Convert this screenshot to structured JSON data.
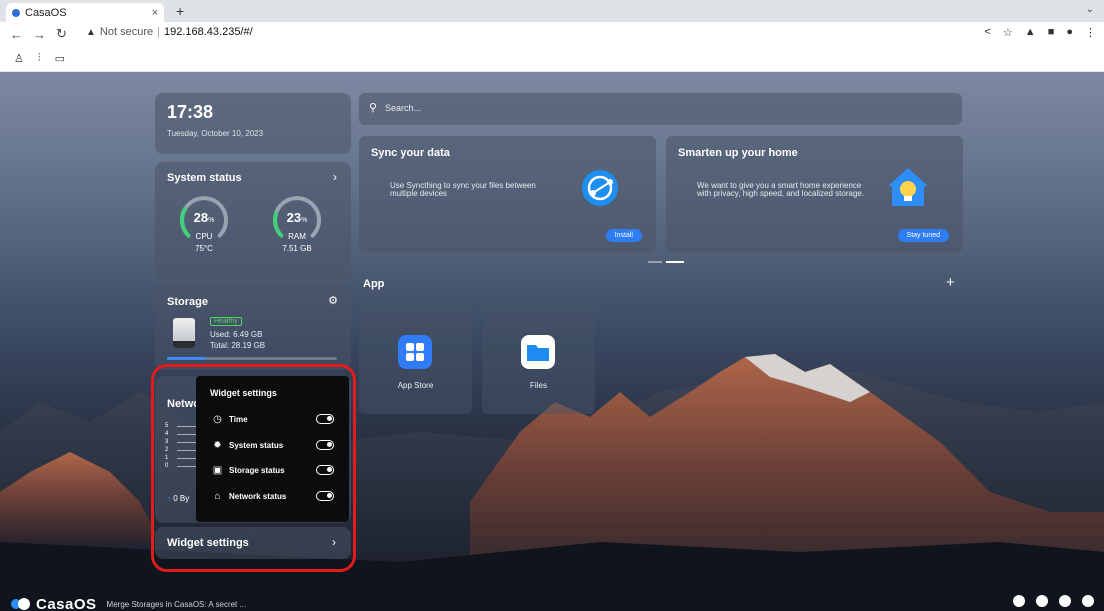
{
  "browser": {
    "tab_title": "CasaOS",
    "tab_close": "×",
    "new_tab": "+",
    "address_warning": "Not secure",
    "address_url": "192.168.43.235/#/"
  },
  "dashboard": {
    "time": "17:38",
    "date": "Tuesday, October 10, 2023",
    "search_placeholder": "Search..."
  },
  "system_status": {
    "title": "System status",
    "cpu": {
      "percent": "28",
      "unit": "%",
      "label": "CPU",
      "detail": "75°C",
      "value": 0.28
    },
    "ram": {
      "percent": "23",
      "unit": "%",
      "label": "RAM",
      "detail": "7.51 GB",
      "value": 0.23
    }
  },
  "storage": {
    "title": "Storage",
    "health": "Healthy",
    "used": "Used: 6.49 GB",
    "total": "Total: 28.19 GB",
    "usage_fraction": 0.23
  },
  "network": {
    "title_partial": "Netwo",
    "axis": [
      "5",
      "4",
      "3",
      "2",
      "1",
      "0"
    ],
    "speed_partial": "0 By"
  },
  "widget_popup": {
    "header": "Widget settings",
    "items": [
      {
        "label": "Time",
        "enabled": true
      },
      {
        "label": "System status",
        "enabled": true
      },
      {
        "label": "Storage status",
        "enabled": true
      },
      {
        "label": "Network status",
        "enabled": true
      }
    ]
  },
  "widget_bar": {
    "label": "Widget settings"
  },
  "banners": {
    "sync": {
      "title": "Sync your data",
      "desc": "Use Syncthing to sync your files between multiple devices",
      "button": "Install"
    },
    "smart": {
      "title": "Smarten up your home",
      "desc": "We want to give you a smart home experience with privacy, high speed, and localized storage.",
      "button": "Stay tuned"
    }
  },
  "apps": {
    "title": "App",
    "items": [
      {
        "name": "App Store"
      },
      {
        "name": "Files"
      }
    ]
  },
  "footer": {
    "brand": "CasaOS",
    "news": "Merge Storages in CasaOS: A secret ..."
  },
  "colors": {
    "accent": "#2e7cf6",
    "healthy": "#55d36a",
    "gauge_green": "#3fd07a",
    "highlight_red": "#e01c1c"
  }
}
